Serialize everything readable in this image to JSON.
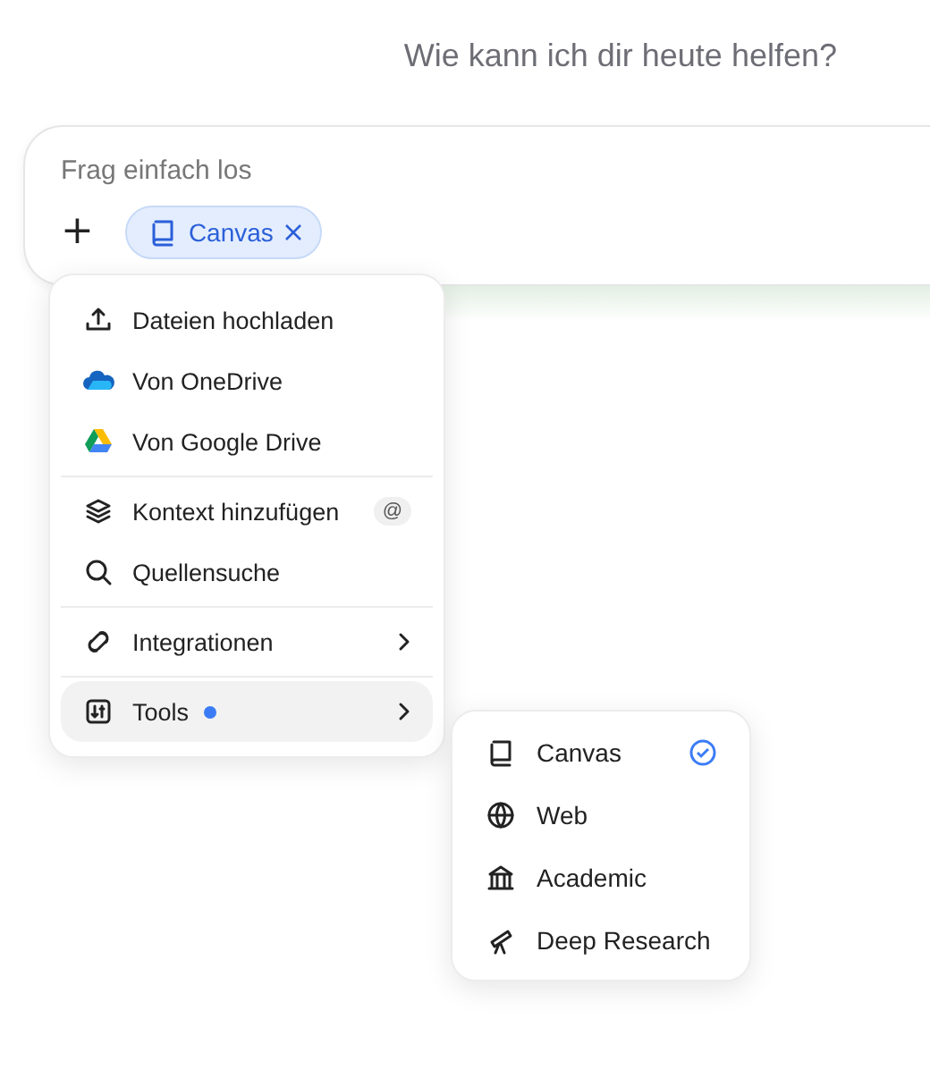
{
  "subtitle": "Wie kann ich dir heute helfen?",
  "composer": {
    "placeholder": "Frag einfach los",
    "add_button": "+",
    "chip": {
      "label": "Canvas"
    }
  },
  "menu": {
    "groups": [
      {
        "items": [
          {
            "label": "Dateien hochladen",
            "selected": false
          },
          {
            "label": "Von OneDrive",
            "selected": false
          },
          {
            "label": "Von Google Drive",
            "selected": false
          }
        ]
      },
      {
        "items": [
          {
            "label": "Kontext hinzufügen",
            "badge": "@",
            "selected": false
          },
          {
            "label": "Quellensuche",
            "selected": false
          }
        ]
      },
      {
        "items": [
          {
            "label": "Integrationen",
            "submenu": true,
            "selected": false
          }
        ]
      },
      {
        "items": [
          {
            "label": "Tools",
            "submenu": true,
            "dot": true,
            "selected": true
          }
        ]
      }
    ]
  },
  "submenu": {
    "items": [
      {
        "label": "Canvas",
        "checked": true
      },
      {
        "label": "Web",
        "checked": false
      },
      {
        "label": "Academic",
        "checked": false
      },
      {
        "label": "Deep Research",
        "checked": false
      }
    ]
  }
}
